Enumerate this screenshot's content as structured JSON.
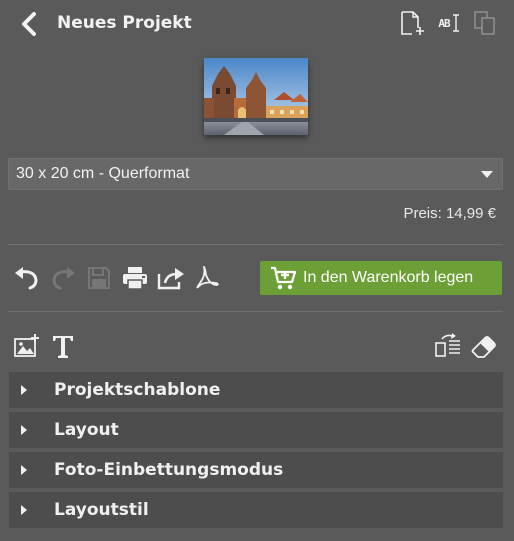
{
  "header": {
    "title": "Neues Projekt",
    "text_tool_label": "AB"
  },
  "project": {
    "format": "30 x 20 cm - Querformat",
    "price": "Preis: 14,99 €"
  },
  "toolbar": {
    "cart_label": "In den Warenkorb legen",
    "cart_color": "#6c9f35"
  },
  "panels": [
    {
      "label": "Projektschablone"
    },
    {
      "label": "Layout"
    },
    {
      "label": "Foto-Einbettungsmodus"
    },
    {
      "label": "Layoutstil"
    }
  ]
}
